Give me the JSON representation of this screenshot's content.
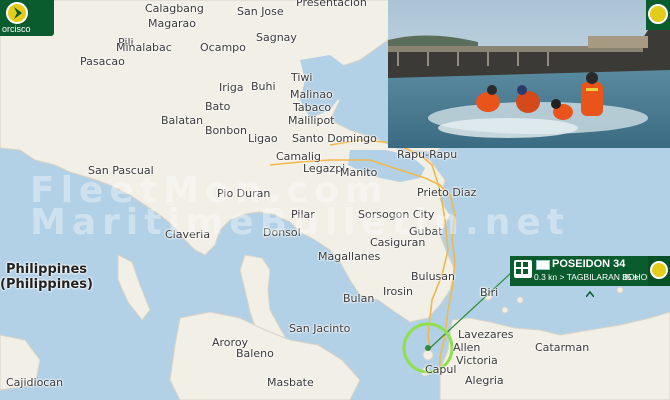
{
  "app": {
    "corner_label": "orcisco"
  },
  "watermark": {
    "line1": "FleetMon.com",
    "line2": "MaritimeBulletin.net"
  },
  "places": {
    "calagbang": "Calagbang",
    "magarao": "Magarao",
    "san_jose": "San Jose",
    "presentacion": "Presentacion",
    "pili": "Pili",
    "minalabac": "Minalabac",
    "ocampo": "Ocampo",
    "sagnay": "Sagnay",
    "pasacao": "Pasacao",
    "tiwi": "Tiwi",
    "buhi": "Buhi",
    "iriga": "Iriga",
    "malinao": "Malinao",
    "bato": "Bato",
    "tabaco": "Tabaco",
    "malilipot": "Malilipot",
    "balatan": "Balatan",
    "bonbon": "Bonbon",
    "ligao": "Ligao",
    "santo_domingo": "Santo Domingo",
    "camalig": "Camalig",
    "legazpi": "Legazpi",
    "manito": "Manito",
    "rapu_rapu": "Rapu-Rapu",
    "prieto_diaz": "Prieto Diaz",
    "san_pascual": "San Pascual",
    "pio_duran": "Pio Duran",
    "sorsogon_city": "Sorsogon City",
    "pilar": "Pilar",
    "donsol": "Donsol",
    "gubat": "Gubat",
    "claveria": "Claveria",
    "casiguran": "Casiguran",
    "magallanes": "Magallanes",
    "bulusan": "Bulusan",
    "irosin": "Irosin",
    "bulan": "Bulan",
    "biri": "Biri",
    "san_jacinto": "San Jacinto",
    "lavezares": "Lavezares",
    "allen": "Allen",
    "aroroy": "Aroroy",
    "baleno": "Baleno",
    "victoria": "Victoria",
    "catarman": "Catarman",
    "capul": "Capul",
    "alegria": "Alegria",
    "masbate": "Masbate",
    "cajidiocan": "Cajidiocan",
    "philippines1": "Philippines",
    "philippines2": "(Philippines)"
  },
  "vessel": {
    "name": "POSEIDON 34",
    "info": "0.3 kn > TAGBILARAN BOHOL",
    "age": "35 s"
  },
  "colors": {
    "sea": "#b3d1e6",
    "land": "#f2efe6",
    "track": "#f2b84b",
    "highlight_circle": "#8ee04a",
    "panel": "#0a5c2f",
    "logo": "#e4cc1b"
  }
}
